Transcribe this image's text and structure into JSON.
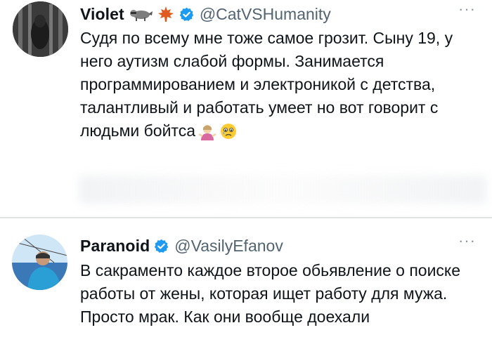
{
  "tweets": [
    {
      "display_name": "Violet",
      "handle": "@CatVSHumanity",
      "verified": true,
      "name_emojis": [
        "raccoon-emoji",
        "maple-leaf-emoji"
      ],
      "text": "Судя по всему мне тоже самое грозит. Сыну 19, у него аутизм слабой формы. Занимается программированием и электроникой с детства, талантливый и работать умеет но вот говорит с людьми бойтса",
      "trailing_emojis": [
        "person-shrugging-emoji",
        "face-holding-back-tears-emoji"
      ],
      "more_label": "···"
    },
    {
      "display_name": "Paranoid",
      "handle": "@VasilyEfanov",
      "verified": true,
      "text": "В сакраменто каждое второе обьявление о поиске работы от жены, которая ищет работу для мужа. Просто мрак. Как они вообще доехали",
      "more_label": "···"
    }
  ],
  "colors": {
    "text": "#0f1419",
    "secondary": "#536471",
    "verified_badge": "#1d9bf0",
    "divider": "#dfe3e6"
  }
}
